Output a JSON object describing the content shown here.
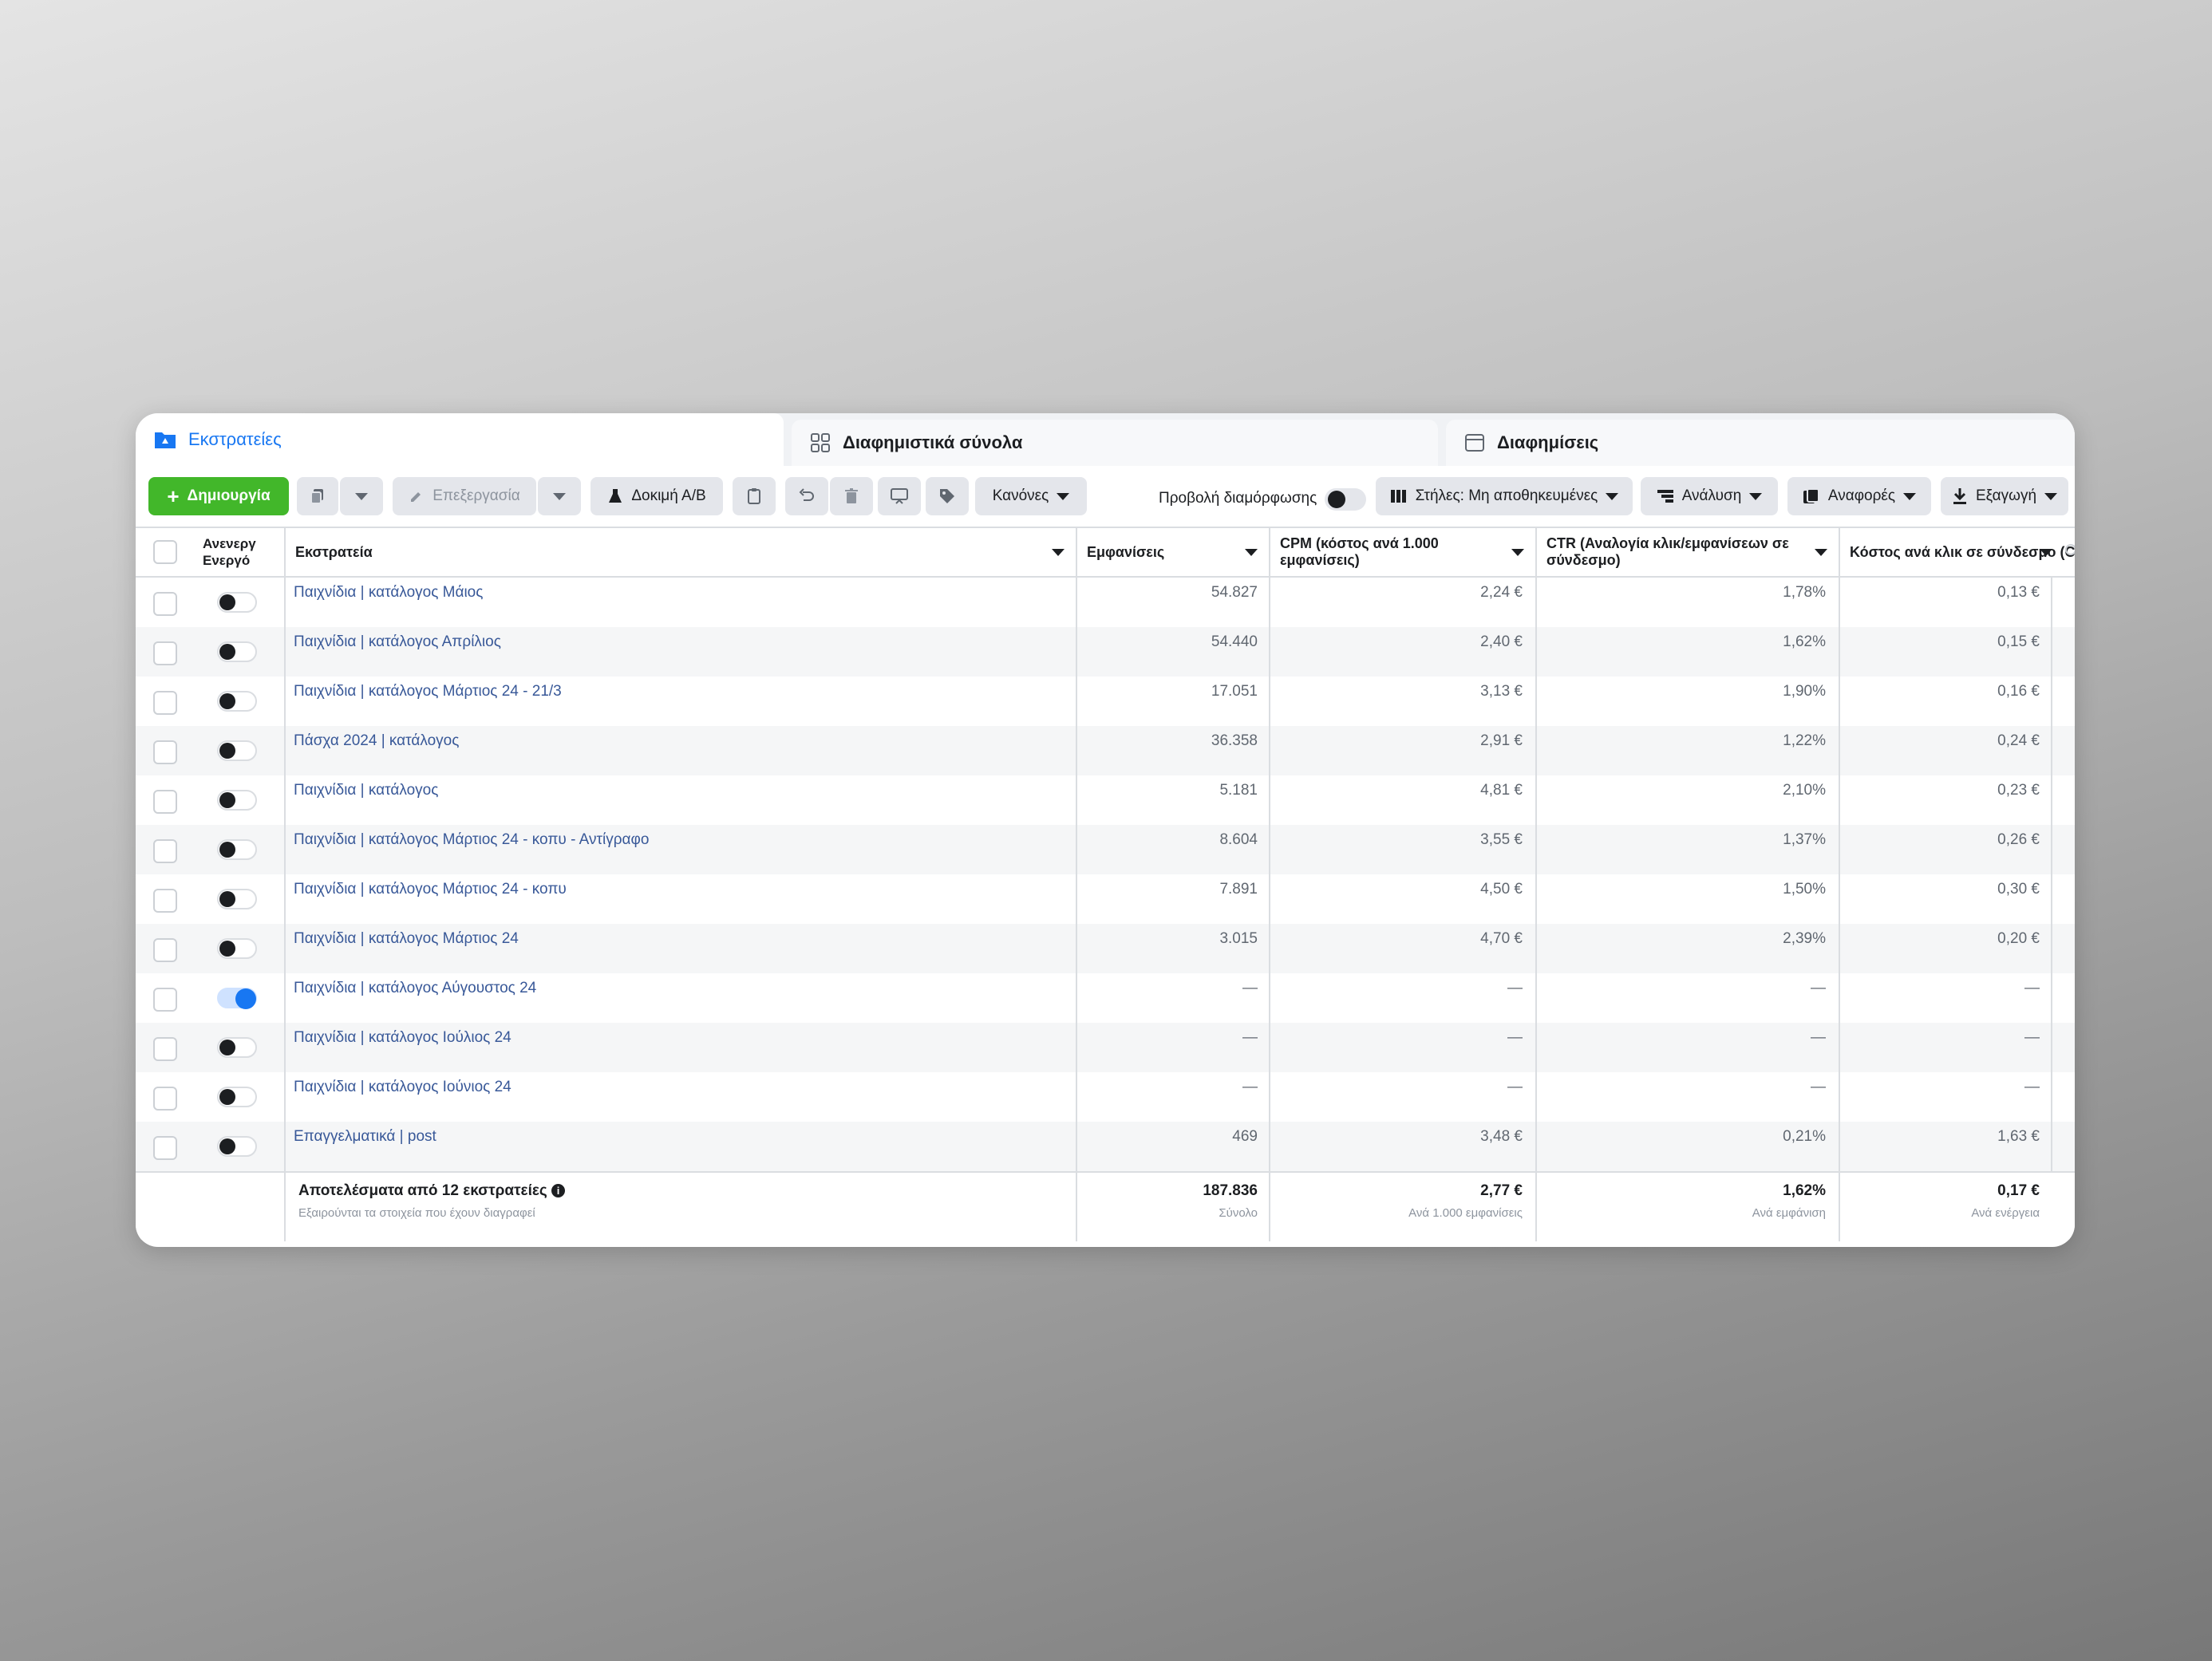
{
  "tabs": [
    {
      "label": "Εκστρατείες",
      "icon": "folder-icon"
    },
    {
      "label": "Διαφημιστικά σύνολα",
      "icon": "grid-icon"
    },
    {
      "label": "Διαφημίσεις",
      "icon": "ad-window-icon"
    }
  ],
  "toolbar": {
    "create_label": "Δημιουργία",
    "edit_label": "Επεξεργασία",
    "ab_test_label": "Δοκιμή Α/Β",
    "rules_label": "Κανόνες",
    "preview_label": "Προβολή διαμόρφωσης",
    "columns_label": "Στήλες: Μη αποθηκευμένες",
    "breakdown_label": "Ανάλυση",
    "reports_label": "Αναφορές",
    "export_label": "Εξαγωγή"
  },
  "table": {
    "headers": {
      "toggle_line1": "Ανενεργ",
      "toggle_line2": "Ενεργό",
      "campaign": "Εκστρατεία",
      "impressions": "Εμφανίσεις",
      "cpm_line1": "CPM (κόστος ανά 1.000",
      "cpm_line2": "εμφανίσεις)",
      "ctr_line1": "CTR (Αναλογία κλικ/εμφανίσεων σε",
      "ctr_line2": "σύνδεσμο)",
      "cpc": "Κόστος ανά κλικ σε σύνδεσμο (CPC)"
    },
    "rows": [
      {
        "name": "Παιχνίδια | κατάλογος Μάιος",
        "active": false,
        "impressions": "54.827",
        "cpm": "2,24 €",
        "ctr": "1,78%",
        "cpc": "0,13 €"
      },
      {
        "name": "Παιχνίδια | κατάλογος Απρίλιος",
        "active": false,
        "impressions": "54.440",
        "cpm": "2,40 €",
        "ctr": "1,62%",
        "cpc": "0,15 €"
      },
      {
        "name": "Παιχνίδια | κατάλογος Μάρτιος 24 - 21/3",
        "active": false,
        "impressions": "17.051",
        "cpm": "3,13 €",
        "ctr": "1,90%",
        "cpc": "0,16 €"
      },
      {
        "name": "Πάσχα 2024 | κατάλογος",
        "active": false,
        "impressions": "36.358",
        "cpm": "2,91 €",
        "ctr": "1,22%",
        "cpc": "0,24 €"
      },
      {
        "name": "Παιχνίδια | κατάλογος",
        "active": false,
        "impressions": "5.181",
        "cpm": "4,81 €",
        "ctr": "2,10%",
        "cpc": "0,23 €"
      },
      {
        "name": "Παιχνίδια | κατάλογος Μάρτιος 24 - κοπυ - Αντίγραφο",
        "active": false,
        "impressions": "8.604",
        "cpm": "3,55 €",
        "ctr": "1,37%",
        "cpc": "0,26 €"
      },
      {
        "name": "Παιχνίδια | κατάλογος Μάρτιος 24 - κοπυ",
        "active": false,
        "impressions": "7.891",
        "cpm": "4,50 €",
        "ctr": "1,50%",
        "cpc": "0,30 €"
      },
      {
        "name": "Παιχνίδια | κατάλογος Μάρτιος 24",
        "active": false,
        "impressions": "3.015",
        "cpm": "4,70 €",
        "ctr": "2,39%",
        "cpc": "0,20 €"
      },
      {
        "name": "Παιχνίδια | κατάλογος Αύγουστος 24",
        "active": true,
        "impressions": "—",
        "cpm": "—",
        "ctr": "—",
        "cpc": "—"
      },
      {
        "name": "Παιχνίδια | κατάλογος Ιούλιος 24",
        "active": false,
        "impressions": "—",
        "cpm": "—",
        "ctr": "—",
        "cpc": "—"
      },
      {
        "name": "Παιχνίδια | κατάλογος Ιούνιος 24",
        "active": false,
        "impressions": "—",
        "cpm": "—",
        "ctr": "—",
        "cpc": "—"
      },
      {
        "name": "Επαγγελματικά | post",
        "active": false,
        "impressions": "469",
        "cpm": "3,48 €",
        "ctr": "0,21%",
        "cpc": "1,63 €"
      }
    ],
    "footer": {
      "title": "Αποτελέσματα από 12 εκστρατείες",
      "subtitle": "Εξαιρούνται τα στοιχεία που έχουν διαγραφεί",
      "impressions": "187.836",
      "impressions_sub": "Σύνολο",
      "cpm": "2,77 €",
      "cpm_sub": "Ανά 1.000 εμφανίσεις",
      "ctr": "1,62%",
      "ctr_sub": "Ανά εμφάνιση",
      "cpc": "0,17 €",
      "cpc_sub": "Ανά ενέργεια"
    }
  },
  "colors": {
    "accent": "#1877f2",
    "link": "#385898",
    "create_button": "#42b72a"
  }
}
